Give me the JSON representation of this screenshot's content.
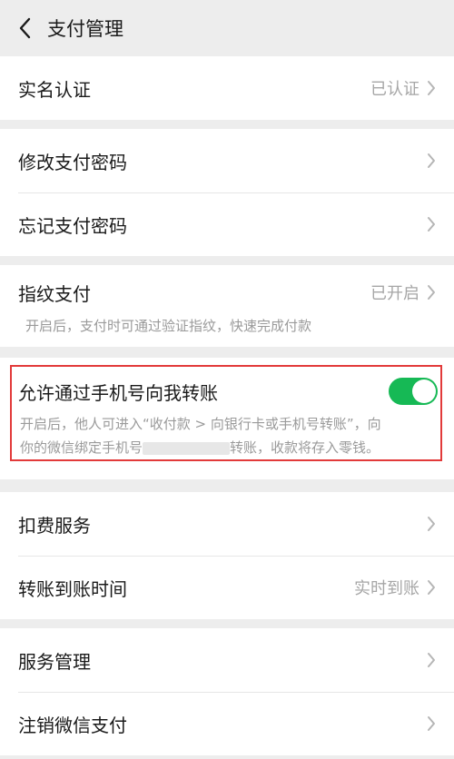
{
  "header": {
    "title": "支付管理"
  },
  "group1": {
    "real_name_label": "实名认证",
    "real_name_value": "已认证"
  },
  "group2": {
    "change_pwd_label": "修改支付密码",
    "forgot_pwd_label": "忘记支付密码"
  },
  "group3": {
    "fingerprint_label": "指纹支付",
    "fingerprint_value": "已开启",
    "fingerprint_desc": "开启后，支付时可通过验证指纹，快速完成付款"
  },
  "group4": {
    "phone_transfer_label": "允许通过手机号向我转账",
    "phone_transfer_on": true,
    "desc_line1": "开启后，他人可进入“收付款 > 向银行卡或手机号转账”，向",
    "desc_line2_a": "你的微信绑定手机号",
    "desc_line2_b": "转账，收款将存入零钱。"
  },
  "group5": {
    "deduction_label": "扣费服务",
    "arrival_label": "转账到账时间",
    "arrival_value": "实时到账"
  },
  "group6": {
    "service_label": "服务管理",
    "cancel_label": "注销微信支付"
  }
}
